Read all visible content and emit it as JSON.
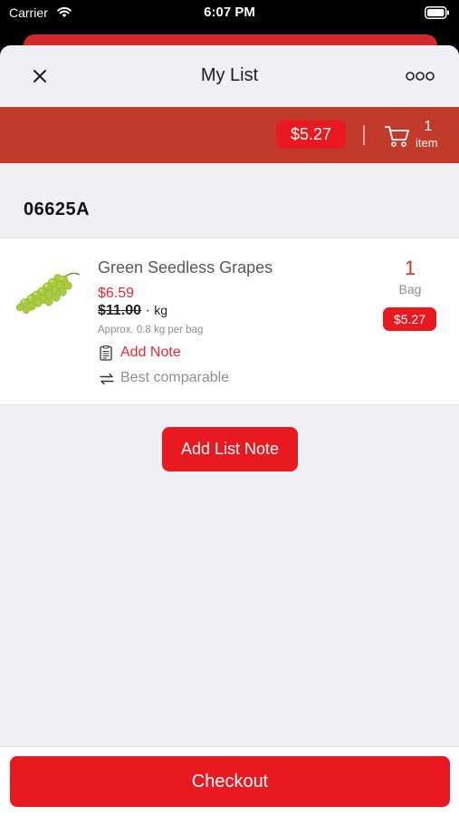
{
  "status_bar": {
    "carrier": "Carrier",
    "time": "6:07 PM"
  },
  "header": {
    "title": "My List",
    "close_icon": "close-icon",
    "more_icon": "more-options-icon"
  },
  "summary": {
    "total": "$5.27",
    "cart_count": "1",
    "cart_label": "item"
  },
  "list": {
    "store_code": "06625A",
    "items": [
      {
        "name": "Green Seedless Grapes",
        "sale_price": "$6.59",
        "regular_price": "$11.00",
        "unit": "kg",
        "approx": "Approx. 0.8 kg per bag",
        "add_note_label": "Add Note",
        "comparable_label": "Best comparable",
        "quantity": "1",
        "quantity_unit": "Bag",
        "line_total": "$5.27"
      }
    ]
  },
  "actions": {
    "add_list_note": "Add List Note",
    "checkout": "Checkout"
  },
  "colors": {
    "primary_red": "#e8191f",
    "header_bar": "#c23a2b",
    "sale_text": "#e52a2f",
    "background": "#efeff4"
  }
}
